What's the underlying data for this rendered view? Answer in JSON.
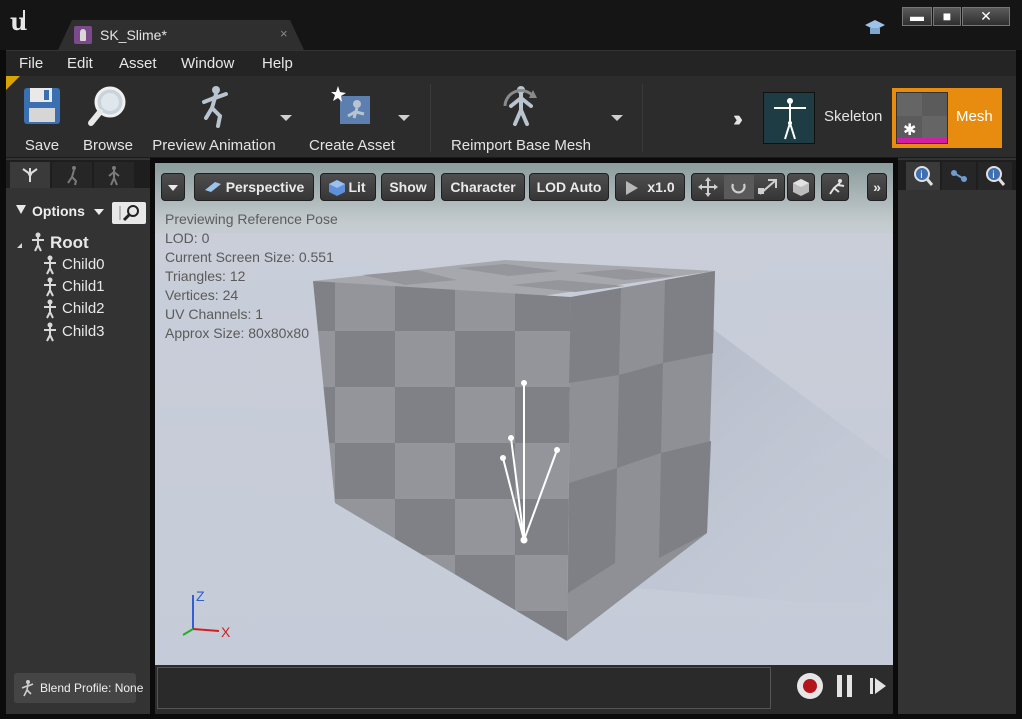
{
  "window": {
    "tab_title": "SK_Slime*",
    "tab_close": "×",
    "controls": {
      "minimize": "▬",
      "maximize": "■",
      "close": "✕"
    }
  },
  "menu": [
    "File",
    "Edit",
    "Asset",
    "Window",
    "Help"
  ],
  "toolbar": {
    "save": "Save",
    "browse": "Browse",
    "preview_animation": "Preview Animation",
    "create_asset": "Create Asset",
    "reimport": "Reimport Base Mesh",
    "modes": {
      "skeleton": "Skeleton",
      "mesh": "Mesh"
    },
    "accent": "#e78c0f"
  },
  "skeleton_tree": {
    "options": "Options",
    "root": "Root",
    "children": [
      "Child0",
      "Child1",
      "Child2",
      "Child3"
    ],
    "blend_profile": "Blend Profile: None"
  },
  "viewport": {
    "buttons": {
      "perspective": "Perspective",
      "lit": "Lit",
      "show": "Show",
      "character": "Character",
      "lod": "LOD Auto",
      "speed": "x1.0",
      "overflow": "»"
    },
    "info": [
      "Previewing Reference Pose",
      "LOD: 0",
      "Current Screen Size: 0.551",
      "Triangles: 12",
      "Vertices: 24",
      "UV Channels: 1",
      "Approx Size: 80x80x80"
    ],
    "axis": {
      "z": "Z",
      "x": "X"
    }
  }
}
